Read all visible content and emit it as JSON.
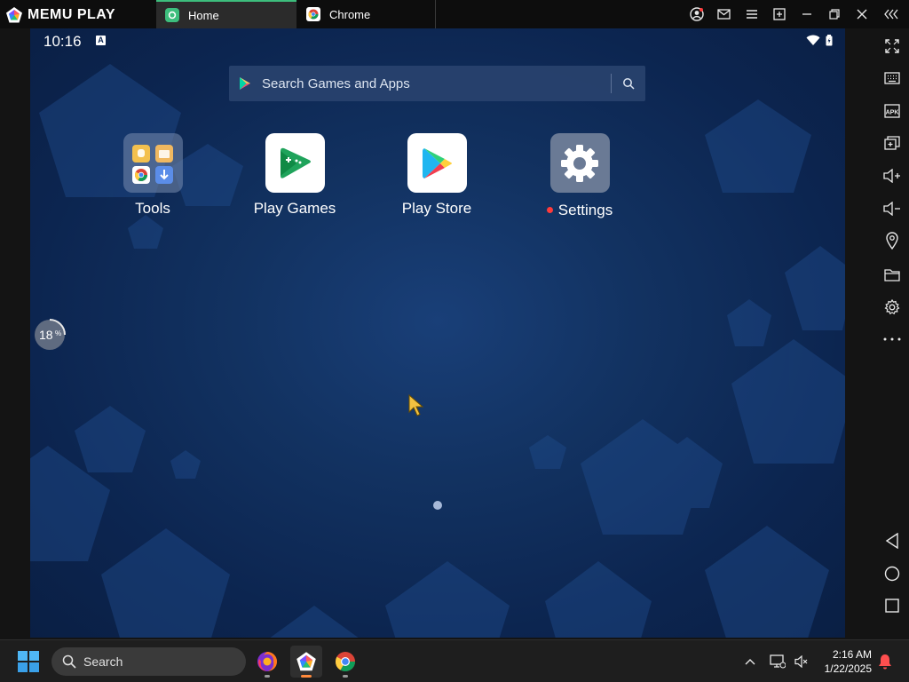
{
  "app": {
    "logo_text": "MEMU PLAY",
    "tabs": [
      {
        "label": "Home",
        "active": true
      },
      {
        "label": "Chrome",
        "active": false
      }
    ]
  },
  "android": {
    "status": {
      "time": "10:16",
      "badge": "A"
    },
    "search": {
      "placeholder": "Search Games and Apps"
    },
    "apps": [
      {
        "label": "Tools",
        "icon": "folder-icon"
      },
      {
        "label": "Play Games",
        "icon": "play-games-icon"
      },
      {
        "label": "Play Store",
        "icon": "play-store-icon"
      },
      {
        "label": "Settings",
        "icon": "gear-icon",
        "notification_dot": true
      }
    ],
    "badge_value": "18",
    "badge_unit": "%"
  },
  "sidebar": {
    "items": [
      "fullscreen-icon",
      "keyboard-icon",
      "apk-icon",
      "multi-window-icon",
      "volume-up-icon",
      "volume-down-icon",
      "location-icon",
      "folder-icon",
      "settings-icon",
      "more-icon",
      "back-icon",
      "home-icon",
      "recents-icon"
    ]
  },
  "taskbar": {
    "search_placeholder": "Search",
    "time": "2:16 AM",
    "date": "1/22/2025"
  },
  "colors": {
    "accent_green": "#3dbe7d",
    "wallpaper": "#123261",
    "notification_red": "#ff3b3b"
  }
}
